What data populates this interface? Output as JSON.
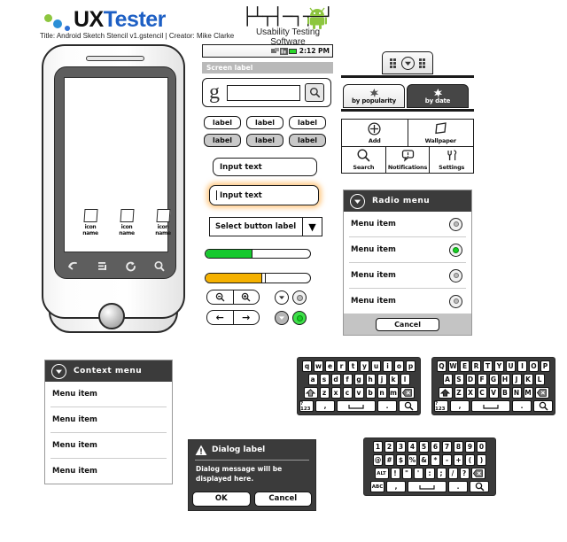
{
  "header": {
    "brand_ux": "UX",
    "brand_tester": "Tester",
    "android_wordmark": "androidTM",
    "android_tagline": "Usability Testing Software",
    "doc_title": "Title: Android Sketch Stencil v1.gstencil  |  Creator: Mike Clarke",
    "brand_color": "#1d5fc4",
    "android_green": "#8dc63f"
  },
  "phone": {
    "home_icons": [
      {
        "label": "icon name"
      },
      {
        "label": "icon name"
      },
      {
        "label": "icon name"
      }
    ],
    "nav": [
      {
        "name": "back-icon",
        "glyph": "↩"
      },
      {
        "name": "menu-icon",
        "glyph": "☰"
      },
      {
        "name": "home-icon",
        "glyph": "↺"
      },
      {
        "name": "search-icon",
        "glyph": "⚲"
      }
    ]
  },
  "statusbar": {
    "time": "2:12 PM",
    "icons": [
      "sync-icon",
      "signal-icon",
      "battery-icon"
    ]
  },
  "screen_label": "Screen label",
  "search_widget": {
    "logo": "g",
    "input_value": "",
    "input_placeholder": "",
    "button_icon": "search-icon"
  },
  "label_buttons": {
    "row1": [
      "label",
      "label",
      "label"
    ],
    "row2": [
      "label",
      "label",
      "label"
    ]
  },
  "inputs": {
    "input1": "Input text",
    "input2": "Input text",
    "focus_color": "#ffa028"
  },
  "select_button": {
    "label": "Select button label",
    "arrow": "▼"
  },
  "bars": {
    "progress": {
      "percent": 45,
      "color": "#16c92e"
    },
    "slider": {
      "percent": 55,
      "color": "#f5b100"
    }
  },
  "seg_buttons": {
    "zoom": [
      {
        "name": "zoom-out-icon"
      },
      {
        "name": "zoom-in-icon"
      }
    ],
    "arrows": [
      {
        "name": "arrow-left-icon",
        "glyph": "←"
      },
      {
        "name": "arrow-right-icon",
        "glyph": "→"
      }
    ]
  },
  "round_buttons": {
    "dropdown1": {
      "state": "off"
    },
    "radio1": {
      "state": "off"
    },
    "dropdown2": {
      "state": "pressed"
    },
    "radio2": {
      "state": "on",
      "color": "#17cf22"
    }
  },
  "widget_tray": {
    "icon": "download-arrow-icon"
  },
  "tabs": [
    {
      "label": "by popularity",
      "selected": false,
      "icon": "star-icon"
    },
    {
      "label": "by date",
      "selected": true,
      "icon": "star-icon"
    }
  ],
  "menu_grid": {
    "row1": [
      {
        "label": "Add",
        "icon": "plus-circle-icon"
      },
      {
        "label": "Wallpaper",
        "icon": "wallpaper-icon"
      }
    ],
    "row2": [
      {
        "label": "Search",
        "icon": "search-icon"
      },
      {
        "label": "Notifications",
        "icon": "speech-bubble-icon"
      },
      {
        "label": "Settings",
        "icon": "tools-icon"
      }
    ]
  },
  "radio_menu": {
    "title": "Radio menu",
    "header_icon": "down-chevron-circle-icon",
    "items": [
      {
        "label": "Menu item",
        "selected": false
      },
      {
        "label": "Menu item",
        "selected": true
      },
      {
        "label": "Menu item",
        "selected": false
      },
      {
        "label": "Menu item",
        "selected": false
      }
    ],
    "cancel": "Cancel"
  },
  "context_menu": {
    "title": "Context menu",
    "header_icon": "down-chevron-circle-icon",
    "items": [
      {
        "label": "Menu item"
      },
      {
        "label": "Menu item"
      },
      {
        "label": "Menu item"
      },
      {
        "label": "Menu item"
      }
    ]
  },
  "dialog": {
    "icon": "warning-triangle-icon",
    "title": "Dialog label",
    "message": "Dialog message will be displayed here.",
    "ok": "OK",
    "cancel": "Cancel"
  },
  "keyboards": {
    "lowercase": {
      "row1": [
        "q",
        "w",
        "e",
        "r",
        "t",
        "y",
        "u",
        "i",
        "o",
        "p"
      ],
      "row2": [
        "a",
        "s",
        "d",
        "f",
        "g",
        "h",
        "j",
        "k",
        "l"
      ],
      "row3": [
        "⇧",
        "z",
        "x",
        "c",
        "v",
        "b",
        "n",
        "m",
        "⌫"
      ],
      "row4": [
        "?123",
        ",",
        "␣",
        ".",
        "search-icon"
      ]
    },
    "uppercase": {
      "row1": [
        "Q",
        "W",
        "E",
        "R",
        "T",
        "Y",
        "U",
        "I",
        "O",
        "P"
      ],
      "row2": [
        "A",
        "S",
        "D",
        "F",
        "G",
        "H",
        "J",
        "K",
        "L"
      ],
      "row3": [
        "⇧",
        "Z",
        "X",
        "C",
        "V",
        "B",
        "N",
        "M",
        "⌫"
      ],
      "row4": [
        "?123",
        ",",
        "␣",
        ".",
        "search-icon"
      ]
    },
    "numeric": {
      "row1": [
        "1",
        "2",
        "3",
        "4",
        "5",
        "6",
        "7",
        "8",
        "9",
        "0"
      ],
      "row2": [
        "@",
        "#",
        "$",
        "%",
        "&",
        "*",
        "-",
        "+",
        "(",
        ")"
      ],
      "row3": [
        "ALT",
        "!",
        "\"",
        "'",
        ":",
        ";",
        "/",
        "?",
        "⌫"
      ],
      "row4": [
        "ABC",
        ",",
        "␣",
        ".",
        "search-icon"
      ]
    }
  }
}
